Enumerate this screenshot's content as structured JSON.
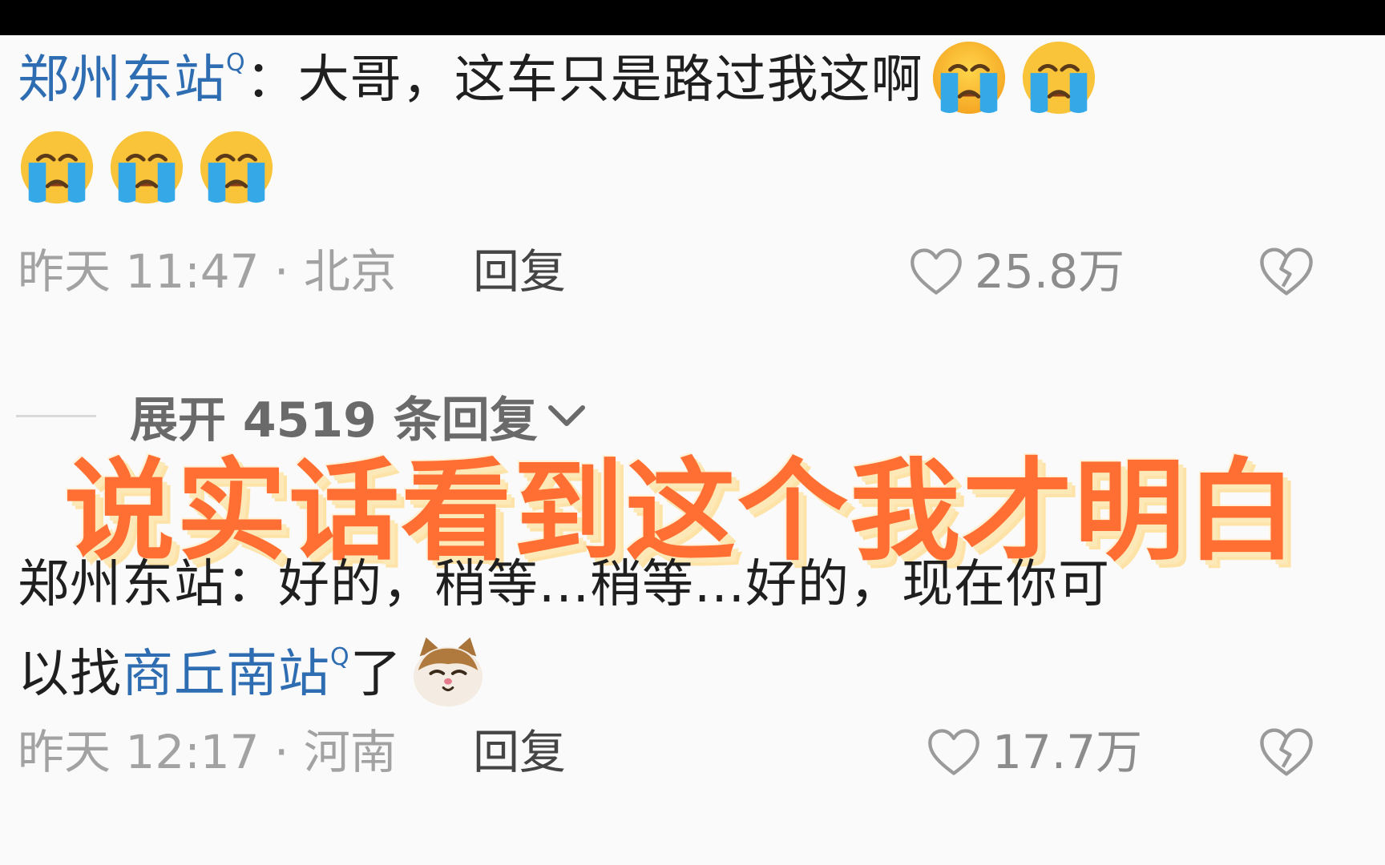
{
  "comments": [
    {
      "user": "郑州东站",
      "search_mark": "Q",
      "separator": "：",
      "text": "大哥，这车只是路过我这啊",
      "emojis": [
        "crying-face",
        "crying-face",
        "crying-face",
        "crying-face",
        "crying-face"
      ],
      "time_location": "昨天 11:47 · 北京",
      "reply_label": "回复",
      "likes": "25.8万"
    },
    {
      "user": "郑州东站",
      "separator": "：",
      "text_a": "好的，稍等...稍等...好的，现在你可",
      "text_b": "以找",
      "mention": "商丘南站",
      "search_mark": "Q",
      "text_c": "了",
      "emoji": "cat-face",
      "time_location": "昨天 12:17 · 河南",
      "reply_label": "回复",
      "likes": "17.7万"
    }
  ],
  "expand_replies": "展开 4519 条回复",
  "overlay_caption": "说实话看到这个我才明白",
  "colors": {
    "link": "#2f6db3",
    "caption": "#ff6f33",
    "meta": "#a2a2a2",
    "background": "#fafafa"
  }
}
